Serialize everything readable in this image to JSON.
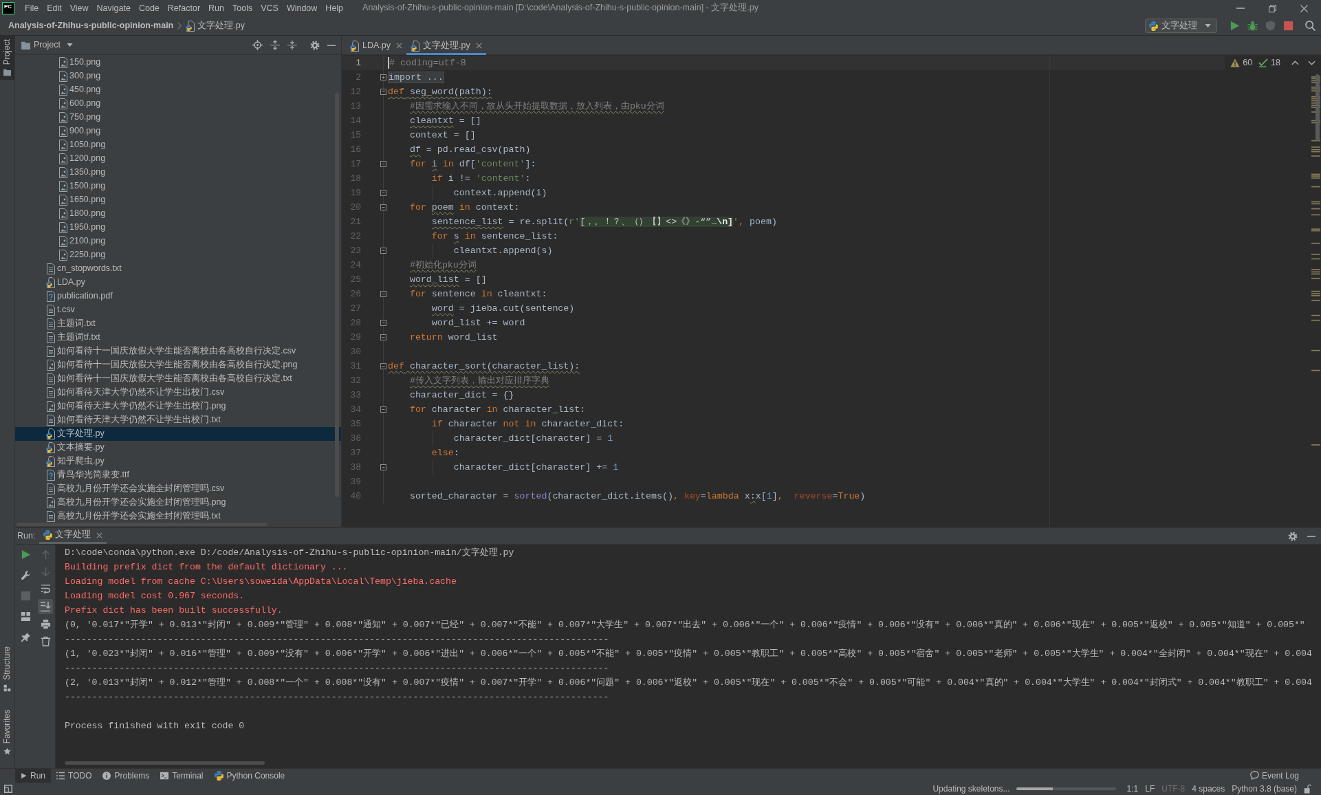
{
  "title_bar": {
    "logo": "PC",
    "menu": [
      "File",
      "Edit",
      "View",
      "Navigate",
      "Code",
      "Refactor",
      "Run",
      "Tools",
      "VCS",
      "Window",
      "Help"
    ],
    "title": "Analysis-of-Zhihu-s-public-opinion-main [D:\\code\\Analysis-of-Zhihu-s-public-opinion-main] - 文字处理.py"
  },
  "nav_bar": {
    "crumbs": [
      {
        "label": "Analysis-of-Zhihu-s-public-opinion-main",
        "kind": "project"
      },
      {
        "label": "文字处理.py",
        "kind": "python"
      }
    ],
    "run_config": "文字处理",
    "actions": [
      {
        "kind": "run",
        "disabled": false
      },
      {
        "kind": "debug",
        "disabled": false
      },
      {
        "kind": "coverage",
        "disabled": true
      },
      {
        "kind": "stop",
        "disabled": false
      },
      {
        "kind": "search",
        "disabled": false
      }
    ]
  },
  "left_stripe": {
    "top": [
      {
        "label": "Project",
        "kind": "folder",
        "selected": true
      }
    ],
    "bottom": [
      {
        "label": "Structure",
        "kind": "structure",
        "selected": false
      },
      {
        "label": "Favorites",
        "kind": "star",
        "selected": false
      }
    ]
  },
  "project": {
    "title": "Project",
    "tree": [
      {
        "children": [
          {
            "name": "150.png",
            "kind": "image",
            "selected": false
          },
          {
            "name": "300.png",
            "kind": "image",
            "selected": false
          },
          {
            "name": "450.png",
            "kind": "image",
            "selected": false
          },
          {
            "name": "600.png",
            "kind": "image",
            "selected": false
          },
          {
            "name": "750.png",
            "kind": "image",
            "selected": false
          },
          {
            "name": "900.png",
            "kind": "image",
            "selected": false
          },
          {
            "name": "1050.png",
            "kind": "image",
            "selected": false
          },
          {
            "name": "1200.png",
            "kind": "image",
            "selected": false
          },
          {
            "name": "1350.png",
            "kind": "image",
            "selected": false
          },
          {
            "name": "1500.png",
            "kind": "image",
            "selected": false
          },
          {
            "name": "1650.png",
            "kind": "image",
            "selected": false
          },
          {
            "name": "1800.png",
            "kind": "image",
            "selected": false
          },
          {
            "name": "1950.png",
            "kind": "image",
            "selected": false
          },
          {
            "name": "2100.png",
            "kind": "image",
            "selected": false
          },
          {
            "name": "2250.png",
            "kind": "image",
            "selected": false
          }
        ]
      },
      {
        "name": "cn_stopwords.txt",
        "kind": "text",
        "selected": false
      },
      {
        "name": "LDA.py",
        "kind": "python",
        "selected": false
      },
      {
        "name": "publication.pdf",
        "kind": "unknown",
        "selected": false
      },
      {
        "name": "t.csv",
        "kind": "text",
        "selected": false
      },
      {
        "name": "主题词.txt",
        "kind": "text",
        "selected": false
      },
      {
        "name": "主题词tf.txt",
        "kind": "text",
        "selected": false
      },
      {
        "name": "如何看待十一国庆放假大学生能否离校由各高校自行决定.csv",
        "kind": "text",
        "selected": false
      },
      {
        "name": "如何看待十一国庆放假大学生能否离校由各高校自行决定.png",
        "kind": "image",
        "selected": false
      },
      {
        "name": "如何看待十一国庆放假大学生能否离校由各高校自行决定.txt",
        "kind": "text",
        "selected": false
      },
      {
        "name": "如何看待天津大学仍然不让学生出校门.csv",
        "kind": "text",
        "selected": false
      },
      {
        "name": "如何看待天津大学仍然不让学生出校门.png",
        "kind": "image",
        "selected": false
      },
      {
        "name": "如何看待天津大学仍然不让学生出校门.txt",
        "kind": "text",
        "selected": false
      },
      {
        "name": "文字处理.py",
        "kind": "python",
        "selected": true
      },
      {
        "name": "文本摘要.py",
        "kind": "python",
        "selected": false
      },
      {
        "name": "知乎爬虫.py",
        "kind": "python",
        "selected": false
      },
      {
        "name": "青鸟华光简隶变.ttf",
        "kind": "unknown",
        "selected": false
      },
      {
        "name": "高校九月份开学还会实施全封闭管理吗.csv",
        "kind": "text",
        "selected": false
      },
      {
        "name": "高校九月份开学还会实施全封闭管理吗.png",
        "kind": "image",
        "selected": false
      },
      {
        "name": "高校九月份开学还会实施全封闭管理吗.txt",
        "kind": "text",
        "selected": false
      }
    ]
  },
  "editor": {
    "tabs": [
      {
        "label": "LDA.py",
        "selected": false
      },
      {
        "label": "文字处理.py",
        "selected": true
      }
    ],
    "inspections": {
      "warnings": "60",
      "weak_warnings": "18"
    },
    "lines": [
      {
        "number": "1",
        "current": true,
        "kind": "plain",
        "tokens": [
          {
            "text": "# coding=utf-8",
            "kind": "comment",
            "warn": false
          }
        ]
      },
      {
        "number": "2",
        "current": false,
        "kind": "folded",
        "tokens": [
          {
            "text": "import ...",
            "kind": "folded",
            "warn": false
          }
        ]
      },
      {
        "number": "12",
        "current": false,
        "kind": "opener",
        "tokens": [
          {
            "text": "def",
            "kind": "keyword",
            "warn": true
          },
          {
            "text": " seg_word(path):",
            "kind": "plain",
            "warn": true
          }
        ],
        "children": [
          {
            "number": "13",
            "current": false,
            "kind": "plain",
            "tokens": [
              {
                "text": "#因需求输入不同，故从头开始提取数据，放入列表，由pku分词",
                "kind": "comment",
                "warn": true
              }
            ]
          },
          {
            "number": "14",
            "current": false,
            "kind": "plain",
            "tokens": [
              {
                "text": "cleantxt",
                "kind": "plain",
                "warn": true
              },
              {
                "text": " = []",
                "kind": "plain",
                "warn": false
              }
            ]
          },
          {
            "number": "15",
            "current": false,
            "kind": "plain",
            "tokens": [
              {
                "text": "context = []",
                "kind": "plain",
                "warn": false
              }
            ]
          },
          {
            "number": "16",
            "current": false,
            "kind": "plain",
            "tokens": [
              {
                "text": "df",
                "kind": "plain",
                "warn": true
              },
              {
                "text": " = pd.read_csv(path)",
                "kind": "plain",
                "warn": false
              }
            ]
          },
          {
            "number": "17",
            "current": false,
            "kind": "opener",
            "tokens": [
              {
                "text": "for ",
                "kind": "keyword",
                "warn": false
              },
              {
                "text": "i",
                "kind": "plain",
                "warn": true
              },
              {
                "text": " in",
                "kind": "keyword",
                "warn": false
              },
              {
                "text": " df[",
                "kind": "plain",
                "warn": false
              },
              {
                "text": "'content'",
                "kind": "string",
                "warn": false
              },
              {
                "text": "]:",
                "kind": "plain",
                "warn": false
              }
            ],
            "children": [
              {
                "number": "18",
                "current": false,
                "kind": "plain",
                "tokens": [
                  {
                    "text": "if",
                    "kind": "keyword",
                    "warn": false
                  },
                  {
                    "text": " i != ",
                    "kind": "plain",
                    "warn": false
                  },
                  {
                    "text": "'content'",
                    "kind": "string",
                    "warn": false
                  },
                  {
                    "text": ":",
                    "kind": "plain",
                    "warn": false
                  }
                ],
                "children": [
                  {
                    "number": "19",
                    "current": false,
                    "kind": "closer",
                    "tokens": [
                      {
                        "text": "context.append(i)",
                        "kind": "plain",
                        "warn": false
                      }
                    ]
                  }
                ]
              }
            ]
          },
          {
            "number": "20",
            "current": false,
            "kind": "opener",
            "tokens": [
              {
                "text": "for ",
                "kind": "keyword",
                "warn": false
              },
              {
                "text": "poem",
                "kind": "plain",
                "warn": true
              },
              {
                "text": " in",
                "kind": "keyword",
                "warn": false
              },
              {
                "text": " context:",
                "kind": "plain",
                "warn": false
              }
            ],
            "children": [
              {
                "number": "21",
                "current": false,
                "kind": "plain",
                "tokens": [
                  {
                    "text": "sentence_list",
                    "kind": "plain",
                    "warn": true
                  },
                  {
                    "text": " = re.split(",
                    "kind": "plain",
                    "warn": false
                  },
                  {
                    "text": "r'",
                    "kind": "string",
                    "warn": false
                  },
                  {
                    "text": "[，。！？、（）【】<>《》-“”…",
                    "kind": "regex",
                    "warn": false
                  },
                  {
                    "text": "\\n]",
                    "kind": "regex-escape",
                    "warn": false
                  },
                  {
                    "text": "'",
                    "kind": "string",
                    "warn": false
                  },
                  {
                    "text": ",",
                    "kind": "punct",
                    "warn": false
                  },
                  {
                    "text": " poem)",
                    "kind": "plain",
                    "warn": false
                  }
                ]
              },
              {
                "number": "22",
                "current": false,
                "kind": "plain",
                "tokens": [
                  {
                    "text": "for ",
                    "kind": "keyword",
                    "warn": false
                  },
                  {
                    "text": "s",
                    "kind": "plain",
                    "warn": true
                  },
                  {
                    "text": " in",
                    "kind": "keyword",
                    "warn": false
                  },
                  {
                    "text": " sentence_list:",
                    "kind": "plain",
                    "warn": false
                  }
                ],
                "children": [
                  {
                    "number": "23",
                    "current": false,
                    "kind": "closer",
                    "tokens": [
                      {
                        "text": "cleantxt.append(s)",
                        "kind": "plain",
                        "warn": false
                      }
                    ]
                  }
                ]
              }
            ]
          },
          {
            "number": "24",
            "current": false,
            "kind": "plain",
            "tokens": [
              {
                "text": "#初始化pku分词",
                "kind": "comment",
                "warn": true
              }
            ]
          },
          {
            "number": "25",
            "current": false,
            "kind": "plain",
            "tokens": [
              {
                "text": "word_list",
                "kind": "plain",
                "warn": true
              },
              {
                "text": " = []",
                "kind": "plain",
                "warn": false
              }
            ]
          },
          {
            "number": "26",
            "current": false,
            "kind": "opener",
            "tokens": [
              {
                "text": "for",
                "kind": "keyword",
                "warn": false
              },
              {
                "text": " sentence ",
                "kind": "plain",
                "warn": false
              },
              {
                "text": "in",
                "kind": "keyword",
                "warn": false
              },
              {
                "text": " cleantxt:",
                "kind": "plain",
                "warn": false
              }
            ],
            "children": [
              {
                "number": "27",
                "current": false,
                "kind": "plain",
                "tokens": [
                  {
                    "text": "word",
                    "kind": "plain",
                    "warn": true
                  },
                  {
                    "text": " = jieba.cut(sentence)",
                    "kind": "plain",
                    "warn": false
                  }
                ]
              },
              {
                "number": "28",
                "current": false,
                "kind": "closer",
                "tokens": [
                  {
                    "text": "word_list += word",
                    "kind": "plain",
                    "warn": false
                  }
                ]
              }
            ]
          },
          {
            "number": "29",
            "current": false,
            "kind": "closer",
            "tokens": [
              {
                "text": "return",
                "kind": "keyword",
                "warn": false
              },
              {
                "text": " word_list",
                "kind": "plain",
                "warn": false
              }
            ]
          }
        ]
      },
      {
        "number": "30",
        "current": false,
        "kind": "plain"
      },
      {
        "number": "31",
        "current": false,
        "kind": "opener",
        "tokens": [
          {
            "text": "def",
            "kind": "keyword",
            "warn": true
          },
          {
            "text": " character_sort(character_list):",
            "kind": "plain",
            "warn": true
          }
        ],
        "children": [
          {
            "number": "32",
            "current": false,
            "kind": "plain",
            "tokens": [
              {
                "text": "#传入文字列表，输出对应排序字典",
                "kind": "comment",
                "warn": true
              }
            ]
          },
          {
            "number": "33",
            "current": false,
            "kind": "plain",
            "tokens": [
              {
                "text": "character_dict = {}",
                "kind": "plain",
                "warn": false
              }
            ]
          },
          {
            "number": "34",
            "current": false,
            "kind": "opener",
            "tokens": [
              {
                "text": "for",
                "kind": "keyword",
                "warn": false
              },
              {
                "text": " character ",
                "kind": "plain",
                "warn": false
              },
              {
                "text": "in",
                "kind": "keyword",
                "warn": false
              },
              {
                "text": " character_list:",
                "kind": "plain",
                "warn": false
              }
            ],
            "children": [
              {
                "number": "35",
                "current": false,
                "kind": "plain",
                "tokens": [
                  {
                    "text": "if",
                    "kind": "keyword",
                    "warn": false
                  },
                  {
                    "text": " character ",
                    "kind": "plain",
                    "warn": false
                  },
                  {
                    "text": "not in",
                    "kind": "keyword",
                    "warn": false
                  },
                  {
                    "text": " character_dict:",
                    "kind": "plain",
                    "warn": false
                  }
                ],
                "children": [
                  {
                    "number": "36",
                    "current": false,
                    "kind": "plain",
                    "tokens": [
                      {
                        "text": "character_dict[character] = ",
                        "kind": "plain",
                        "warn": false
                      },
                      {
                        "text": "1",
                        "kind": "number",
                        "warn": false
                      }
                    ]
                  }
                ]
              },
              {
                "number": "37",
                "current": false,
                "kind": "plain",
                "tokens": [
                  {
                    "text": "else",
                    "kind": "keyword",
                    "warn": false
                  },
                  {
                    "text": ":",
                    "kind": "plain",
                    "warn": false
                  }
                ],
                "children": [
                  {
                    "number": "38",
                    "current": false,
                    "kind": "closer",
                    "tokens": [
                      {
                        "text": "character_dict[character] += ",
                        "kind": "plain",
                        "warn": false
                      },
                      {
                        "text": "1",
                        "kind": "number",
                        "warn": false
                      }
                    ]
                  }
                ]
              }
            ]
          },
          {
            "number": "39",
            "current": false,
            "kind": "plain"
          },
          {
            "number": "40",
            "current": false,
            "kind": "plain",
            "tokens": [
              {
                "text": "sorted_character = ",
                "kind": "plain",
                "warn": false
              },
              {
                "text": "sorted",
                "kind": "builtin",
                "warn": false
              },
              {
                "text": "(character_dict.items()",
                "kind": "plain",
                "warn": false
              },
              {
                "text": ", ",
                "kind": "punct",
                "warn": false
              },
              {
                "text": "key",
                "kind": "kwarg",
                "warn": false
              },
              {
                "text": "=",
                "kind": "plain",
                "warn": false
              },
              {
                "text": "lambda",
                "kind": "keyword",
                "warn": false
              },
              {
                "text": " x",
                "kind": "plain",
                "warn": false
              },
              {
                "text": ":",
                "kind": "plain",
                "warn": true
              },
              {
                "text": "x[",
                "kind": "plain",
                "warn": false
              },
              {
                "text": "1",
                "kind": "number",
                "warn": false
              },
              {
                "text": "]",
                "kind": "plain",
                "warn": false
              },
              {
                "text": ",  ",
                "kind": "punct",
                "warn": false
              },
              {
                "text": "reverse",
                "kind": "kwarg",
                "warn": false
              },
              {
                "text": "=",
                "kind": "plain",
                "warn": false
              },
              {
                "text": "True",
                "kind": "keyword",
                "warn": false
              },
              {
                "text": ")",
                "kind": "plain",
                "warn": false
              }
            ]
          }
        ]
      }
    ]
  },
  "run": {
    "label": "Run:",
    "tabs": [
      {
        "label": "文字处理",
        "selected": true
      }
    ],
    "tools": [
      [
        {
          "kind": "rerun",
          "disabled": false,
          "on": false
        },
        {
          "kind": "wrench",
          "disabled": false,
          "on": false
        },
        {
          "kind": "stop",
          "disabled": true,
          "on": false
        },
        {
          "kind": "layout",
          "disabled": false,
          "on": false
        },
        {
          "kind": "pin",
          "disabled": false,
          "on": false
        }
      ],
      [
        {
          "kind": "up",
          "disabled": true,
          "on": false
        },
        {
          "kind": "down",
          "disabled": true,
          "on": false
        },
        {
          "kind": "wrap",
          "disabled": false,
          "on": false
        },
        {
          "kind": "scroll-end",
          "disabled": false,
          "on": true
        },
        {
          "kind": "print",
          "disabled": false,
          "on": false
        },
        {
          "kind": "trash",
          "disabled": false,
          "on": false
        }
      ]
    ],
    "console": [
      {
        "kind": "command",
        "text": "D:\\code\\conda\\python.exe D:/code/Analysis-of-Zhihu-s-public-opinion-main/文字处理.py"
      },
      {
        "kind": "stderr",
        "text": "Building prefix dict from the default dictionary ..."
      },
      {
        "kind": "stderr",
        "text": "Loading model from cache C:\\Users\\soweida\\AppData\\Local\\Temp\\jieba.cache"
      },
      {
        "kind": "stderr",
        "text": "Loading model cost 0.967 seconds."
      },
      {
        "kind": "stderr",
        "text": "Prefix dict has been built successfully."
      },
      {
        "kind": "stdout",
        "text": "(0, '0.017*\"开学\" + 0.013*\"封闭\" + 0.009*\"管理\" + 0.008*\"通知\" + 0.007*\"已经\" + 0.007*\"不能\" + 0.007*\"大学生\" + 0.007*\"出去\" + 0.006*\"一个\" + 0.006*\"疫情\" + 0.006*\"没有\" + 0.006*\"真的\" + 0.006*\"现在\" + 0.005*\"返校\" + 0.005*\"知道\" + 0.005*\""
      },
      {
        "kind": "stdout",
        "text": "----------------------------------------------------------------------------------------------------"
      },
      {
        "kind": "stdout",
        "text": "(1, '0.023*\"封闭\" + 0.016*\"管理\" + 0.009*\"没有\" + 0.006*\"开学\" + 0.006*\"进出\" + 0.006*\"一个\" + 0.005*\"不能\" + 0.005*\"疫情\" + 0.005*\"教职工\" + 0.005*\"高校\" + 0.005*\"宿舍\" + 0.005*\"老师\" + 0.005*\"大学生\" + 0.004*\"全封闭\" + 0.004*\"现在\" + 0.004"
      },
      {
        "kind": "stdout",
        "text": "----------------------------------------------------------------------------------------------------"
      },
      {
        "kind": "stdout",
        "text": "(2, '0.013*\"封闭\" + 0.012*\"管理\" + 0.008*\"一个\" + 0.008*\"没有\" + 0.007*\"疫情\" + 0.007*\"开学\" + 0.006*\"问题\" + 0.006*\"返校\" + 0.005*\"现在\" + 0.005*\"不会\" + 0.005*\"可能\" + 0.004*\"真的\" + 0.004*\"大学生\" + 0.004*\"封闭式\" + 0.004*\"教职工\" + 0.004"
      },
      {
        "kind": "stdout",
        "text": "----------------------------------------------------------------------------------------------------"
      },
      {
        "kind": "exit",
        "text": "Process finished with exit code 0"
      }
    ]
  },
  "tool_windows": [
    {
      "label": "Run",
      "kind": "run",
      "selected": true
    },
    {
      "label": "TODO",
      "kind": "todo",
      "selected": false
    },
    {
      "label": "Problems",
      "kind": "problems",
      "selected": false
    },
    {
      "label": "Terminal",
      "kind": "terminal",
      "selected": false
    },
    {
      "label": "Python Console",
      "kind": "python",
      "selected": false
    }
  ],
  "event_log": "Event Log",
  "status_bar": {
    "message": "Updating skeletons...",
    "progress": {
      "level": 0.37
    },
    "items": [
      {
        "text": "1:1",
        "disabled": false
      },
      {
        "text": "LF",
        "disabled": false
      },
      {
        "text": "UTF-8",
        "disabled": true
      },
      {
        "text": "4 spaces",
        "disabled": false
      },
      {
        "text": "Python 3.8 (base)",
        "disabled": false
      }
    ]
  }
}
